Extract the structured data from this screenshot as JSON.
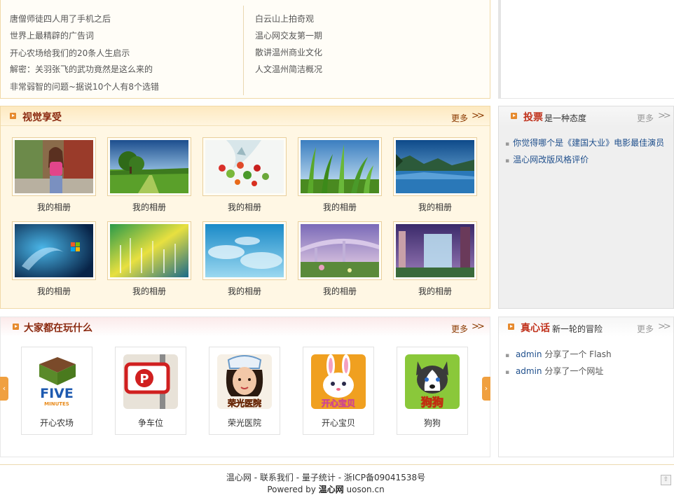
{
  "articles": {
    "left": [
      "唐僧师徒四人用了手机之后",
      "世界上最精辟的广告词",
      "开心农场给我们的20条人生启示",
      "解密：关羽张飞的武功竟然是这么来的",
      "非常弱智的问题~据说10个人有8个选错"
    ],
    "right": [
      "白云山上拍奇观",
      "温心网交友第一期",
      "散讲温州商业文化",
      "人文温州简洁概况"
    ]
  },
  "visual": {
    "title": "视觉享受",
    "more": "更多",
    "more_arrow": ">>",
    "photos": [
      {
        "caption": "我的相册",
        "icon": "portrait-photo"
      },
      {
        "caption": "我的相册",
        "icon": "tree-landscape-photo"
      },
      {
        "caption": "我的相册",
        "icon": "fruit-splash-photo"
      },
      {
        "caption": "我的相册",
        "icon": "grass-photo"
      },
      {
        "caption": "我的相册",
        "icon": "lake-photo"
      },
      {
        "caption": "我的相册",
        "icon": "windows7-photo"
      },
      {
        "caption": "我的相册",
        "icon": "abstract-light-photo"
      },
      {
        "caption": "我的相册",
        "icon": "sky-clouds-photo"
      },
      {
        "caption": "我的相册",
        "icon": "fantasy-bridge-photo"
      },
      {
        "caption": "我的相册",
        "icon": "waterfall-photo"
      }
    ]
  },
  "games": {
    "title": "大家都在玩什么",
    "more": "更多",
    "more_arrow": ">>",
    "items": [
      {
        "label": "开心农场",
        "icon": "five-minutes-game-icon",
        "logo_text": "FIVE",
        "logo_sub": "MINUTES"
      },
      {
        "label": "争车位",
        "icon": "parking-game-icon",
        "logo_text": "P"
      },
      {
        "label": "荣光医院",
        "icon": "nurse-game-icon",
        "logo_text": "荣光医院"
      },
      {
        "label": "开心宝贝",
        "icon": "rabbit-game-icon",
        "logo_text": "开心宝贝"
      },
      {
        "label": "狗狗",
        "icon": "dog-game-icon",
        "logo_text": "狗狗"
      }
    ],
    "prev_arrow": "‹",
    "next_arrow": "›"
  },
  "vote": {
    "title": "投票",
    "subtitle": "是一种态度",
    "more": "更多",
    "more_arrow": ">>",
    "items": [
      "你觉得哪个是《建国大业》电影最佳演员",
      "温心网改版风格评价"
    ]
  },
  "talk": {
    "title": "真心话",
    "subtitle": "新一轮的冒险",
    "more": "更多",
    "more_arrow": ">>",
    "items": [
      {
        "user": "admin",
        "text": " 分享了一个 Flash"
      },
      {
        "user": "admin",
        "text": " 分享了一个网址"
      }
    ]
  },
  "footer": {
    "links": [
      "温心网",
      "联系我们",
      "量子统计",
      "浙ICP备09041538号"
    ],
    "sep": " - ",
    "powered_prefix": "Powered by ",
    "powered_brand": "温心网",
    "powered_domain": " uoson.cn",
    "top_button": "⇧"
  },
  "colors": {
    "accent": "#e68a2e",
    "title": "#8b2a10",
    "link_blue": "#1f4f8c",
    "more_orange": "#8b3a00",
    "more_grey": "#999999"
  }
}
